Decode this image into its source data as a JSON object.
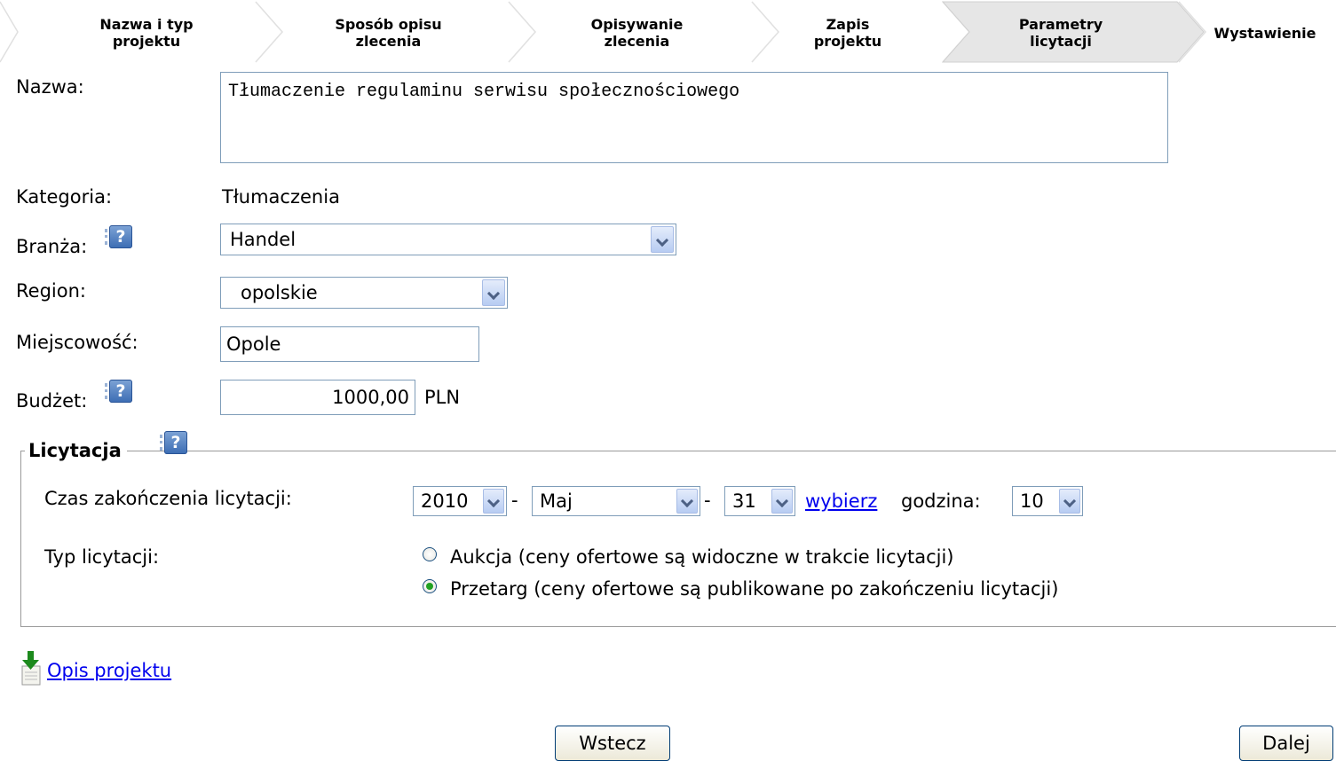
{
  "wizard": {
    "steps": [
      {
        "line1": "Nazwa i typ",
        "line2": "projektu",
        "active": false
      },
      {
        "line1": "Sposób opisu",
        "line2": "zlecenia",
        "active": false
      },
      {
        "line1": "Opisywanie",
        "line2": "zlecenia",
        "active": false
      },
      {
        "line1": "Zapis",
        "line2": "projektu",
        "active": false
      },
      {
        "line1": "Parametry",
        "line2": "licytacji",
        "active": true
      },
      {
        "line1": "Wystawienie",
        "line2": "",
        "active": false
      }
    ]
  },
  "form": {
    "name_label": "Nazwa:",
    "name_value": "Tłumaczenie regulaminu serwisu  społecznościowego",
    "category_label": "Kategoria:",
    "category_value": "Tłumaczenia",
    "industry_label": "Branża:",
    "industry_value": "Handel",
    "region_label": "Region:",
    "region_value": "opolskie",
    "city_label": "Miejscowość:",
    "city_value": "Opole",
    "budget_label": "Budżet:",
    "budget_value": "1000,00",
    "budget_currency": "PLN",
    "help_glyph": "?"
  },
  "auction": {
    "legend": "Licytacja",
    "end_time_label": "Czas zakończenia licytacji:",
    "year": "2010",
    "month": "Maj",
    "day": "31",
    "separator": "-",
    "pick_link": "wybierz",
    "hour_label": "godzina:",
    "hour": "10",
    "type_label": "Typ licytacji:",
    "options": [
      {
        "label": "Aukcja (ceny ofertowe są widoczne w trakcie licytacji)",
        "checked": false
      },
      {
        "label": "Przetarg (ceny ofertowe są publikowane po zakończeniu licytacji)",
        "checked": true
      }
    ]
  },
  "footer": {
    "description_link": "Opis projektu",
    "back_button": "Wstecz",
    "next_button": "Dalej"
  },
  "colors": {
    "link": "#0000ee",
    "active_step": "#e6e6e6",
    "input_border": "#7f9db9"
  },
  "icons": [
    "help-icon",
    "chevron-down-icon",
    "radio-icon",
    "download-document-icon"
  ]
}
